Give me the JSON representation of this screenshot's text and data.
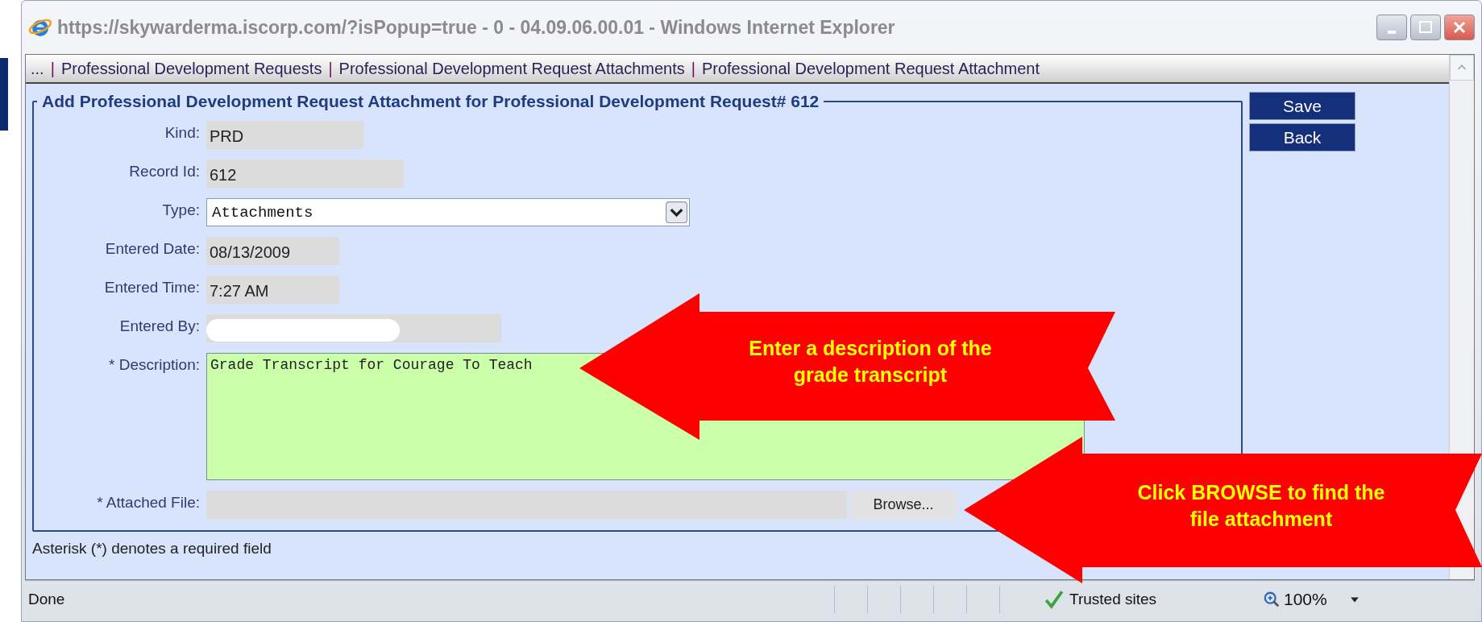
{
  "window": {
    "title": "https://skywarderma.iscorp.com/?isPopup=true - 0 - 04.09.06.00.01 - Windows Internet Explorer"
  },
  "breadcrumb": {
    "separator": "|",
    "items": [
      "...",
      "Professional Development Requests",
      "Professional Development Request Attachments",
      "Professional Development Request Attachment"
    ]
  },
  "form": {
    "title": "Add Professional Development Request Attachment for Professional Development Request# 612",
    "fields": [
      {
        "kind": "readonly",
        "label": "Kind:",
        "value": "PRD"
      },
      {
        "kind": "readonly",
        "label": "Record Id:",
        "value": "612"
      },
      {
        "kind": "select",
        "label": "Type:",
        "value": "Attachments"
      },
      {
        "kind": "readonly",
        "label": "Entered Date:",
        "value": "08/13/2009"
      },
      {
        "kind": "readonly",
        "label": "Entered Time:",
        "value": "7:27 AM"
      },
      {
        "kind": "redacted",
        "label": "Entered By:"
      },
      {
        "kind": "textarea",
        "label": "* Description:",
        "value": "Grade Transcript for Courage To Teach"
      },
      {
        "kind": "file",
        "label": "* Attached File:",
        "button": "Browse..."
      }
    ]
  },
  "buttons": [
    "Save",
    "Back"
  ],
  "footnote": "Asterisk (*) denotes a required field",
  "callouts": [
    {
      "text": "Enter a description of the\ngrade transcript"
    },
    {
      "text": "Click BROWSE to find the\nfile attachment"
    }
  ],
  "status_bar": {
    "status": "Done",
    "zone": "Trusted sites",
    "zoom": "100%"
  }
}
